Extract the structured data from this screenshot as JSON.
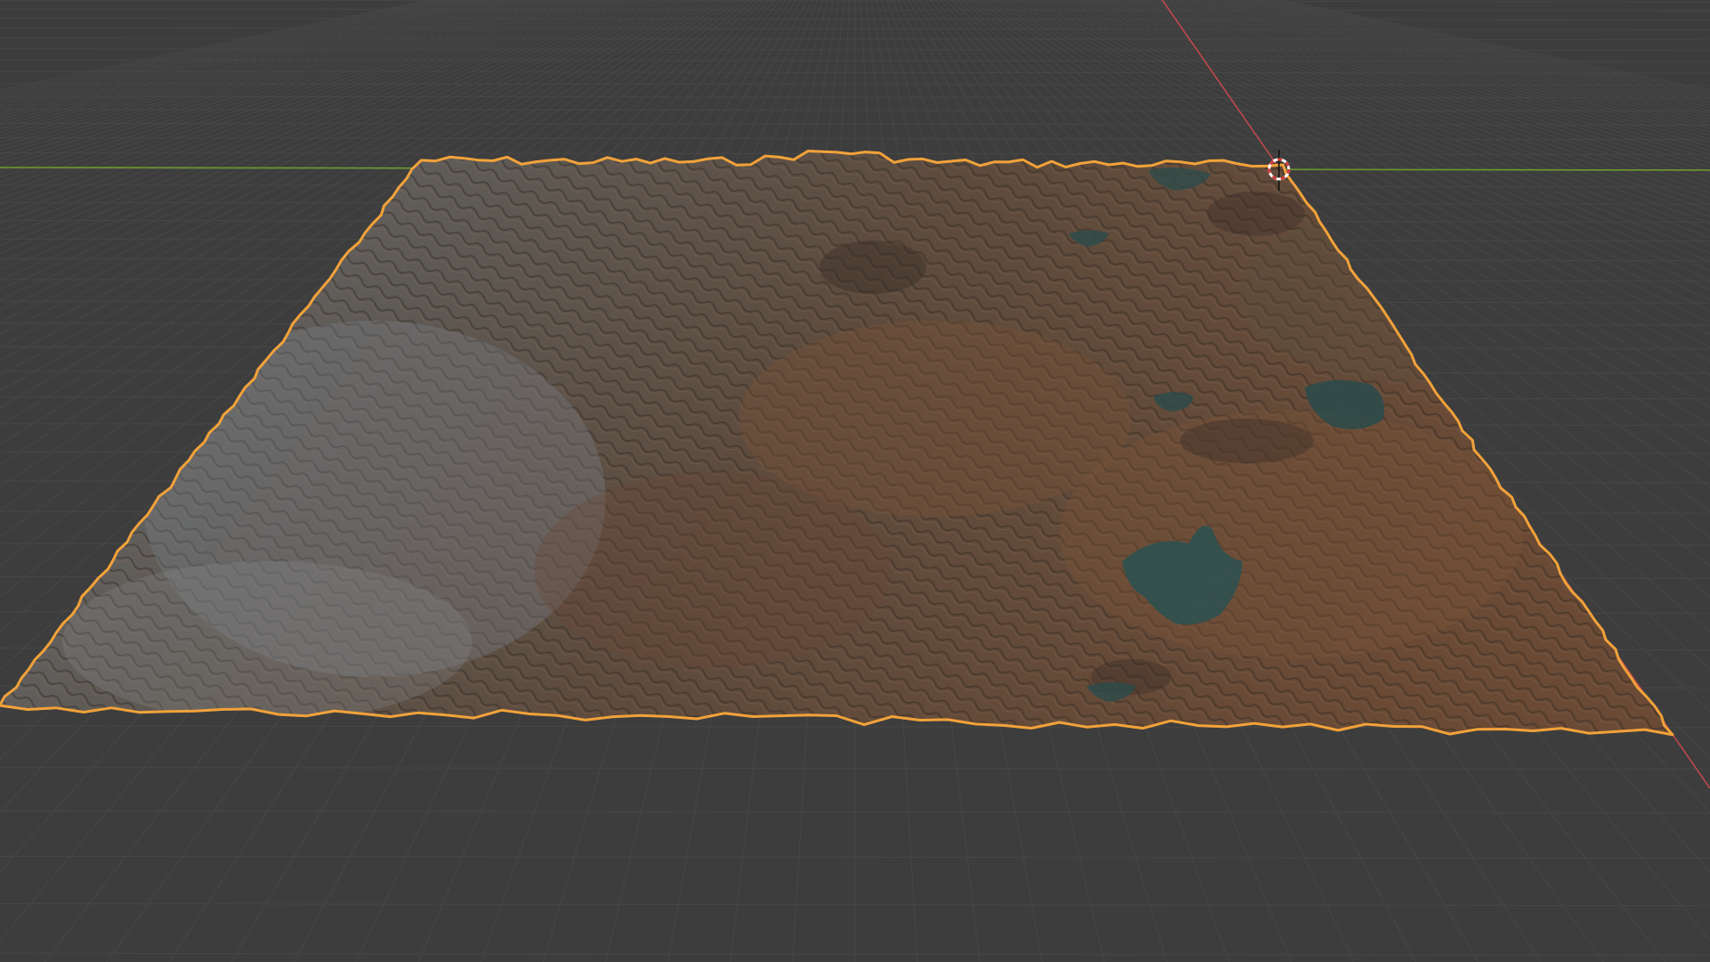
{
  "viewport": {
    "kind": "3d-viewport",
    "background_color": "#3d3d3d",
    "grid_color": "#474747",
    "x_axis_color": "#c0484a",
    "y_axis_color": "#6b9a2e",
    "selection_outline_color": "#f2a23a"
  },
  "scene": {
    "selected_object": "terrain-mesh",
    "object_type": "displaced-terrain-plane",
    "terrain_colors": {
      "base": "#5a4a3c",
      "earth": "#6b4a35",
      "rock": "#6d7178",
      "water": "#2e4b4a"
    }
  },
  "icons": {
    "cursor": "3d-cursor-icon"
  }
}
